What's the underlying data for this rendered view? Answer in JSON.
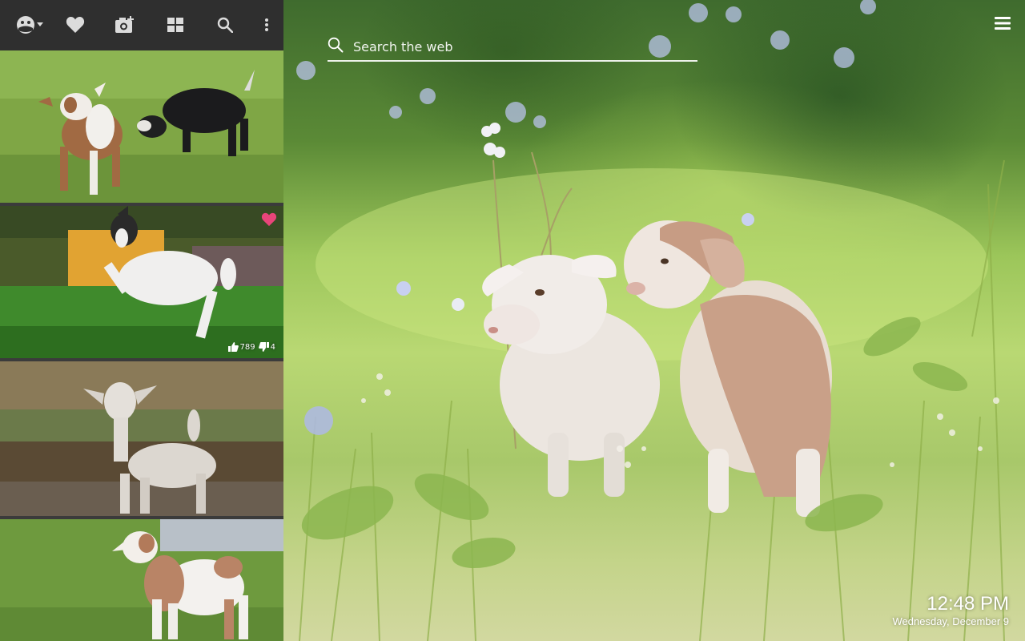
{
  "search": {
    "placeholder": "Search the web"
  },
  "clock": {
    "time": "12:48 PM",
    "date": "Wednesday, December 9"
  },
  "toolbar": {
    "icons": [
      "weather-icon",
      "heart-icon",
      "add-photo-icon",
      "grid-icon",
      "search-icon",
      "more-vert-icon"
    ]
  },
  "thumbnails": [
    {
      "name": "two goat kids grazing"
    },
    {
      "name": "jumping goat kid",
      "favorited": true,
      "likes": "789",
      "dislikes": "4"
    },
    {
      "name": "goat kid standing on rocks"
    },
    {
      "name": "brown and white goat kid"
    }
  ],
  "colors": {
    "toolbar_bg": "#2f2f2f",
    "panel_bg": "#3b3b3b",
    "favorite_pink": "#e8457a",
    "text_white": "#ffffff"
  }
}
